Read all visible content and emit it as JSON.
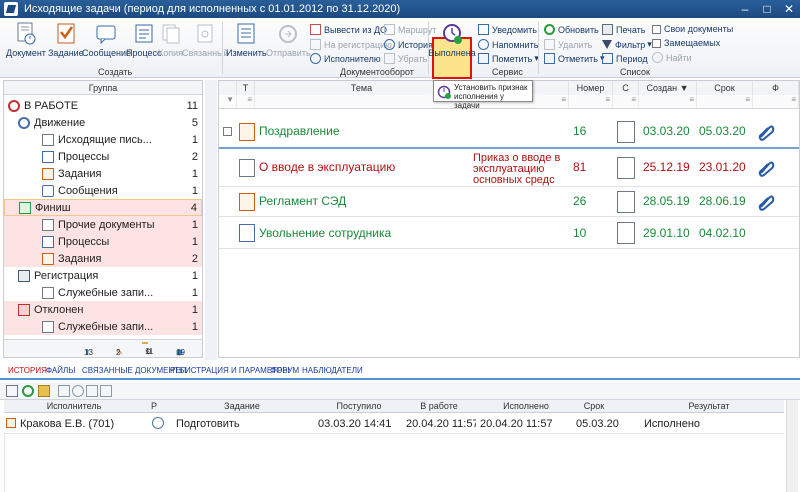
{
  "window": {
    "title": "Исходящие задачи (период для исполненных с 01.01.2012 по 31.12.2020)"
  },
  "ribbon": {
    "create": {
      "group_label": "Создать",
      "document": "Документ",
      "task": "Задание",
      "message": "Сообщение",
      "process": "Процесс",
      "copy": "Копия",
      "linked": "Связанный"
    },
    "docflow": {
      "group_label": "Документооборот",
      "edit": "Изменить",
      "send": "Отправить",
      "remove_from_do": "Вывести из ДО",
      "to_registration": "На регистрацию",
      "executor": "Исполнителю",
      "route": "Маршрут",
      "history": "История",
      "remove": "Убрать"
    },
    "service": {
      "group_label": "Сервис",
      "done": "Выполнена",
      "notify": "Уведомить",
      "remind": "Напомнить",
      "mark": "Пометить"
    },
    "list": {
      "group_label": "Список",
      "refresh": "Обновить",
      "delete": "Удалить",
      "mark_list": "Отметить",
      "print": "Печать",
      "filter": "Фильтр",
      "period": "Период",
      "own_docs": "Свои документы",
      "substituted": "Замещаемых",
      "find": "Найти"
    }
  },
  "tooltip": {
    "text": "Установить признак исполнения у задачи"
  },
  "left_panel": {
    "header": "Группа",
    "tree": [
      {
        "label": "В РАБОТЕ",
        "count": "11",
        "icon": "gears-icon"
      },
      {
        "label": "Движение",
        "count": "5",
        "icon": "motion-icon"
      },
      {
        "label": "Исходящие пись...",
        "count": "1",
        "icon": "document-icon"
      },
      {
        "label": "Процессы",
        "count": "2",
        "icon": "process-icon"
      },
      {
        "label": "Задания",
        "count": "1",
        "icon": "task-icon"
      },
      {
        "label": "Сообщения",
        "count": "1",
        "icon": "message-icon"
      },
      {
        "label": "Финиш",
        "count": "4",
        "icon": "finish-icon"
      },
      {
        "label": "Прочие документы",
        "count": "1",
        "icon": "document-icon"
      },
      {
        "label": "Процессы",
        "count": "1",
        "icon": "process-icon"
      },
      {
        "label": "Задания",
        "count": "2",
        "icon": "task-icon"
      },
      {
        "label": "Регистрация",
        "count": "1",
        "icon": "registry-icon"
      },
      {
        "label": "Служебные запи...",
        "count": "1",
        "icon": "document-icon"
      },
      {
        "label": "Отклонен",
        "count": "1",
        "icon": "rejected-icon"
      },
      {
        "label": "Служебные запи...",
        "count": "1",
        "icon": "document-icon"
      }
    ],
    "footer": [
      "13",
      "2",
      "11",
      "19"
    ]
  },
  "grid": {
    "columns": [
      "Т",
      "Тема",
      "Номер",
      "С",
      "Создан",
      "Срок",
      "Ф"
    ],
    "columns_hidden": "...нта",
    "rows": [
      {
        "subject": "Поздравление",
        "extra": "",
        "number": "16",
        "created": "03.03.20",
        "due": "05.03.20",
        "color": "green"
      },
      {
        "subject": "О вводе в эксплуатацию",
        "extra": "Приказ о вводе в эксплуатацию основных средс",
        "number": "81",
        "created": "25.12.19",
        "due": "23.01.20",
        "color": "red"
      },
      {
        "subject": "Регламент СЭД",
        "extra": "",
        "number": "26",
        "created": "28.05.19",
        "due": "28.06.19",
        "color": "green"
      },
      {
        "subject": "Увольнение сотрудника",
        "extra": "",
        "number": "10",
        "created": "29.01.10",
        "due": "04.02.10",
        "color": "green"
      }
    ]
  },
  "tabs": [
    "ИСТОРИЯ",
    "ФАЙЛЫ",
    "СВЯЗАННЫЕ ДОКУМЕНТЫ",
    "РЕГИСТРАЦИЯ И ПАРАМЕТРЫ",
    "ФОРУМ",
    "НАБЛЮДАТЕЛИ"
  ],
  "history": {
    "columns": [
      "Исполнитель",
      "Р",
      "Задание",
      "Поступило",
      "В работе",
      "Исполнено",
      "Срок",
      "Результат"
    ],
    "rows": [
      {
        "executor": "Кракова Е.В. (701)",
        "task": "Подготовить",
        "received": "03.03.20 14:41",
        "in_work": "20.04.20 11:57",
        "done": "20.04.20 11:57",
        "due": "05.03.20",
        "result": "Исполнено"
      }
    ]
  }
}
